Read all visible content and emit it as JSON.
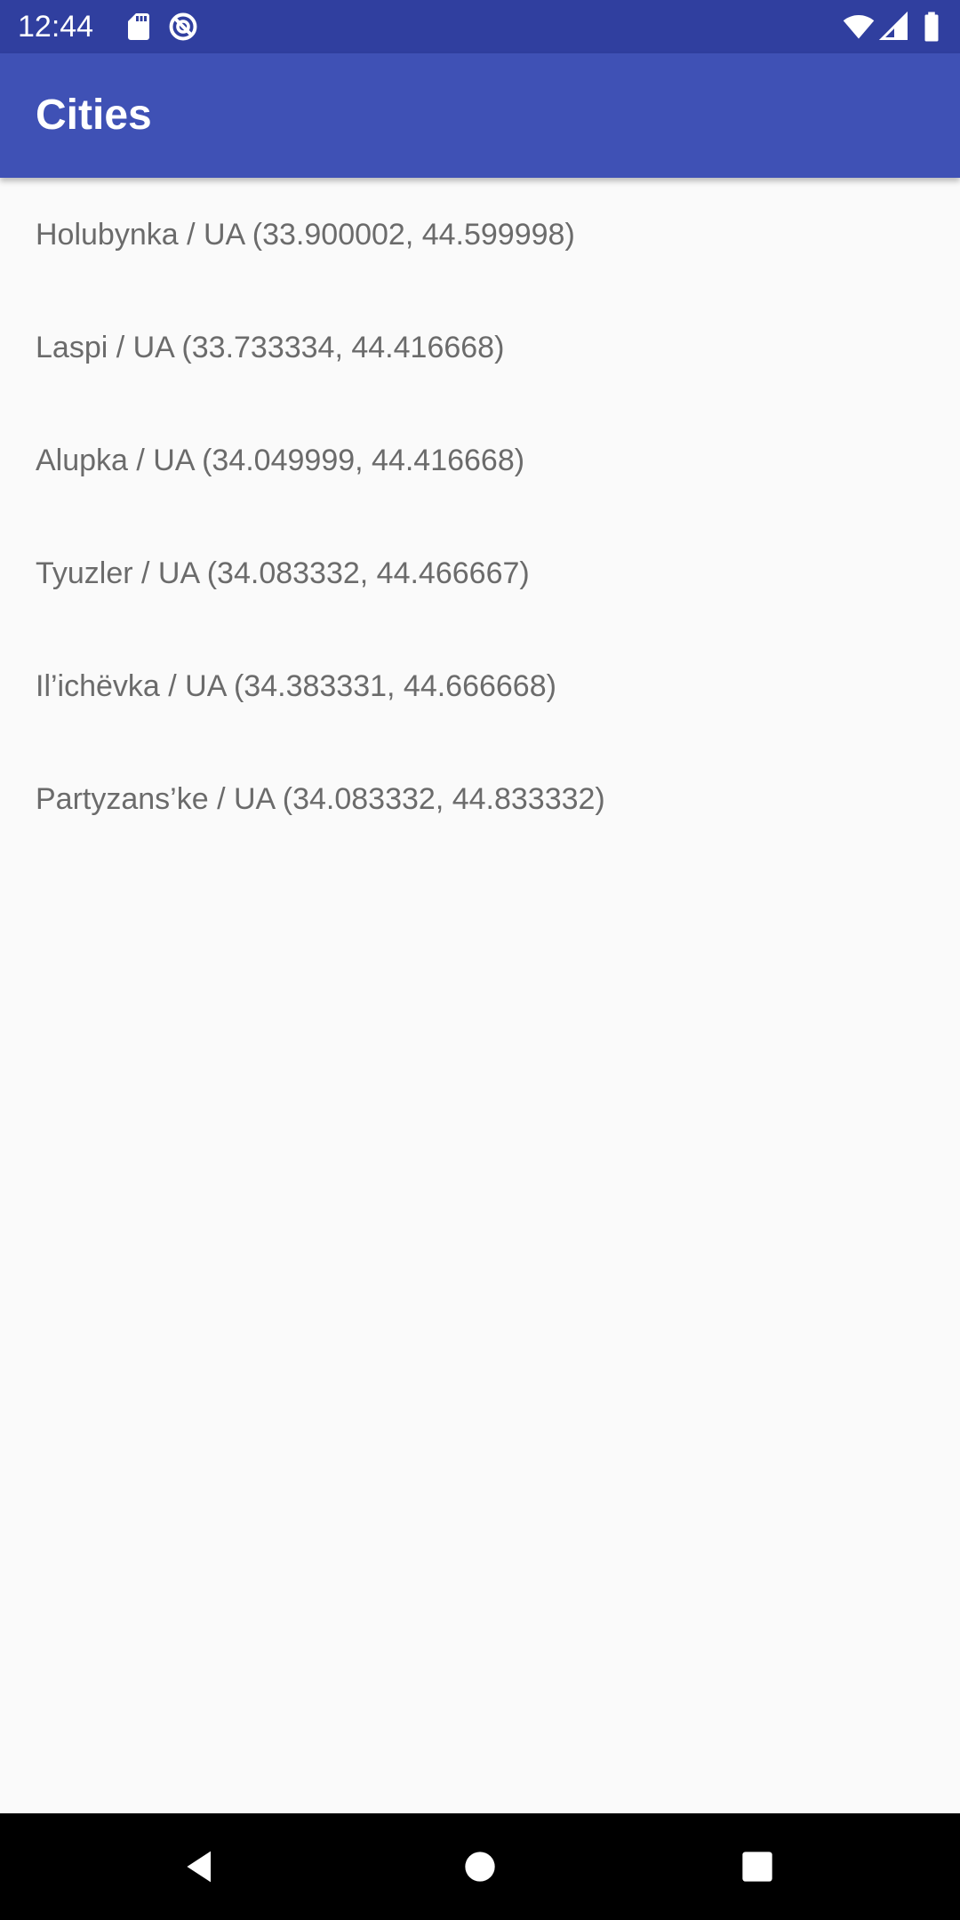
{
  "status_bar": {
    "time": "12:44",
    "icons": [
      "sd-card-icon",
      "sync-disabled-icon",
      "wifi-icon",
      "signal-icon",
      "battery-icon"
    ]
  },
  "app_bar": {
    "title": "Cities"
  },
  "cities": [
    {
      "label": "Holubynka / UA (33.900002, 44.599998)"
    },
    {
      "label": "Laspi / UA (33.733334, 44.416668)"
    },
    {
      "label": "Alupka / UA (34.049999, 44.416668)"
    },
    {
      "label": "Tyuzler / UA (34.083332, 44.466667)"
    },
    {
      "label": "Il’ichëvka / UA (34.383331, 44.666668)"
    },
    {
      "label": "Partyzans’ke / UA (34.083332, 44.833332)"
    }
  ],
  "nav_bar": {
    "buttons": [
      "back-icon",
      "home-icon",
      "recents-icon"
    ]
  },
  "colors": {
    "status_bar": "#303f9f",
    "app_bar": "#3f51b5",
    "background": "#fafafa",
    "text": "#6b6b6b"
  }
}
